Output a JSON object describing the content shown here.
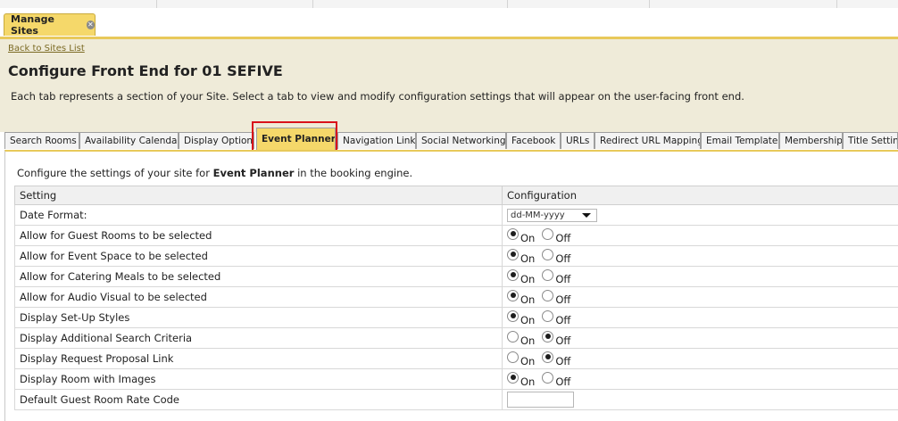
{
  "main_tab": {
    "label": "Manage Sites",
    "close_icon": "close-icon"
  },
  "back_link": "Back to Sites List",
  "page_title": "Configure Front End for 01 SEFIVE",
  "description": "Each tab represents a section of your Site. Select a tab to view and modify configuration settings that will appear on the user-facing front end.",
  "tabs": [
    {
      "label": "Search Rooms"
    },
    {
      "label": "Availability Calendar"
    },
    {
      "label": "Display Options"
    },
    {
      "label": "Event Planner"
    },
    {
      "label": "Navigation Links"
    },
    {
      "label": "Social Networking"
    },
    {
      "label": "Facebook"
    },
    {
      "label": "URLs"
    },
    {
      "label": "Redirect URL Mapping"
    },
    {
      "label": "Email Templates"
    },
    {
      "label": "Membership"
    },
    {
      "label": "Title Settings"
    }
  ],
  "active_tab": "Event Planner",
  "intro": {
    "prefix": "Configure the settings of your site for ",
    "bold": "Event Planner",
    "suffix": " in the booking engine."
  },
  "table": {
    "headers": {
      "setting": "Setting",
      "configuration": "Configuration"
    },
    "date_format": {
      "label": "Date Format:",
      "value": "dd-MM-yyyy"
    },
    "on_label": "On",
    "off_label": "Off",
    "rows": [
      {
        "label": "Allow for Guest Rooms to be selected",
        "selected": "on"
      },
      {
        "label": "Allow for Event Space to be selected",
        "selected": "on"
      },
      {
        "label": "Allow for Catering Meals to be selected",
        "selected": "on"
      },
      {
        "label": "Allow for Audio Visual to be selected",
        "selected": "on"
      },
      {
        "label": "Display Set-Up Styles",
        "selected": "on"
      },
      {
        "label": "Display Additional Search Criteria",
        "selected": "off"
      },
      {
        "label": "Display Request Proposal Link",
        "selected": "off"
      },
      {
        "label": "Display Room with Images",
        "selected": "on"
      }
    ],
    "rate_code": {
      "label": "Default Guest Room Rate Code",
      "value": ""
    }
  },
  "colors": {
    "accent_yellow": "#f5d86a",
    "header_bg": "#efebd9",
    "highlight_red": "#d9121b",
    "link": "#7b6a24"
  }
}
